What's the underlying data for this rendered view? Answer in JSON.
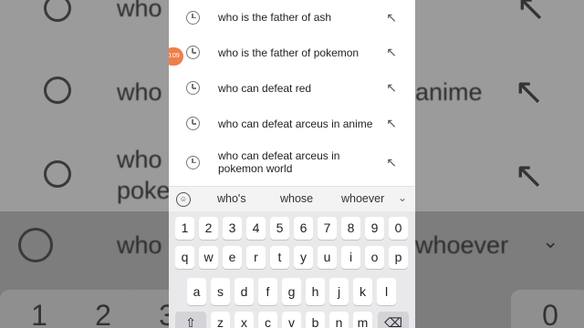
{
  "suggestions": [
    {
      "text": "who is the father of ash",
      "icon": "clock-icon",
      "action_icon": "arrow-up-left-icon"
    },
    {
      "text": "who is the father of pokemon",
      "icon": "clock-icon",
      "action_icon": "arrow-up-left-icon"
    },
    {
      "text": "who can defeat red",
      "icon": "clock-icon",
      "action_icon": "arrow-up-left-icon"
    },
    {
      "text": "who can defeat arceus in anime",
      "icon": "clock-icon",
      "action_icon": "arrow-up-left-icon"
    },
    {
      "text": "who can defeat arceus in pokemon world",
      "icon": "clock-icon",
      "action_icon": "arrow-up-left-icon"
    }
  ],
  "badge": {
    "text": "0:09"
  },
  "predictions": [
    "who's",
    "whose",
    "whoever"
  ],
  "keyboard": {
    "numbers": [
      "1",
      "2",
      "3",
      "4",
      "5",
      "6",
      "7",
      "8",
      "9",
      "0"
    ],
    "row_qwerty": [
      "q",
      "w",
      "e",
      "r",
      "t",
      "y",
      "u",
      "i",
      "o",
      "p"
    ],
    "row_asdf": [
      "a",
      "s",
      "d",
      "f",
      "g",
      "h",
      "j",
      "k",
      "l"
    ],
    "row_zxcv": [
      "z",
      "x",
      "c",
      "v",
      "b",
      "n",
      "m"
    ]
  },
  "background": {
    "rows": [
      "who",
      "who",
      "poke",
      "who"
    ],
    "right_text": [
      "anime",
      "whoever"
    ],
    "keys": [
      "1",
      "2",
      "3",
      "0"
    ]
  },
  "colors": {
    "badge": "#ef7f4a",
    "panel": "#ffffff",
    "keyboard": "#e9e9eb"
  }
}
